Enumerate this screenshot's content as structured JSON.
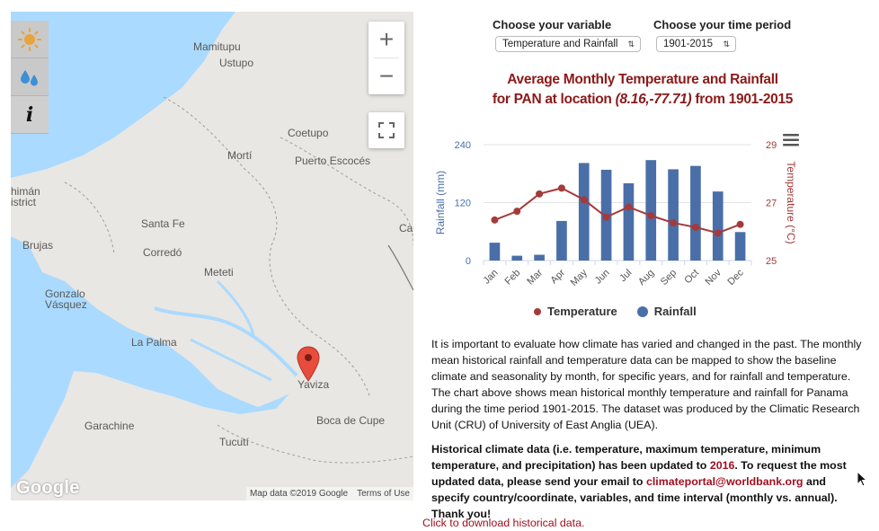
{
  "map": {
    "labels": [
      {
        "id": "mamitupu",
        "text": "Mamitupu"
      },
      {
        "id": "ustupo",
        "text": "Ustupo"
      },
      {
        "id": "coetupo",
        "text": "Coetupo"
      },
      {
        "id": "morti",
        "text": "Mortí"
      },
      {
        "id": "puerto-escoces",
        "text": "Puerto Escocés"
      },
      {
        "id": "chiman",
        "text": "himán"
      },
      {
        "id": "district",
        "text": "istrict"
      },
      {
        "id": "santa-fe",
        "text": "Santa Fe"
      },
      {
        "id": "ca",
        "text": "Ca"
      },
      {
        "id": "brujas",
        "text": "Brujas"
      },
      {
        "id": "corredo",
        "text": "Corredó"
      },
      {
        "id": "meteti",
        "text": "Meteti"
      },
      {
        "id": "gonzalo",
        "text": "Gonzalo"
      },
      {
        "id": "vasquez",
        "text": "Vásquez"
      },
      {
        "id": "la-palma",
        "text": "La Palma"
      },
      {
        "id": "yaviza",
        "text": "Yaviza"
      },
      {
        "id": "boca-de-cupe",
        "text": "Boca de Cupe"
      },
      {
        "id": "garachine",
        "text": "Garachine"
      },
      {
        "id": "tucuti",
        "text": "Tucutí"
      }
    ],
    "zoom_in": "+",
    "zoom_out": "−",
    "info_label": "i",
    "google_logo": "Google",
    "attribution": "Map data ©2019 Google",
    "terms": "Terms of Use"
  },
  "controls": {
    "variable_label": "Choose your variable",
    "variable_value": "Temperature and Rainfall",
    "period_label": "Choose your time period",
    "period_value": "1901-2015"
  },
  "chart_title": {
    "line1": "Average Monthly Temperature and Rainfall",
    "line2_prefix": "for PAN at location ",
    "line2_coords": "(8.16,-77.71)",
    "line2_suffix": " from 1901-2015"
  },
  "chart_data": {
    "type": "bar",
    "categories": [
      "Jan",
      "Feb",
      "Mar",
      "Apr",
      "May",
      "Jun",
      "Jul",
      "Aug",
      "Sep",
      "Oct",
      "Nov",
      "Dec"
    ],
    "series": [
      {
        "name": "Rainfall",
        "type": "bar",
        "axis": "left",
        "values": [
          37,
          10,
          12,
          82,
          202,
          188,
          160,
          208,
          189,
          196,
          143,
          59
        ]
      },
      {
        "name": "Temperature",
        "type": "line",
        "axis": "right",
        "values": [
          26.4,
          26.7,
          27.3,
          27.5,
          27.1,
          26.5,
          26.85,
          26.55,
          26.3,
          26.15,
          25.95,
          26.25
        ]
      }
    ],
    "ylabel_left": "Rainfall (mm)",
    "ylabel_right": "Temperature (°C)",
    "ylim_left": [
      0,
      240
    ],
    "yticks_left": [
      "0",
      "120",
      "240"
    ],
    "ylim_right": [
      25,
      29
    ],
    "yticks_right": [
      "25",
      "27",
      "29"
    ],
    "legend": "bottom-center",
    "grid": true,
    "colors": {
      "rainfall": "#4a6fa8",
      "temperature": "#a53a3a"
    }
  },
  "text": {
    "paragraph1": "It is important to evaluate how climate has varied and changed in the past. The monthly mean historical rainfall and temperature data can be mapped to show the baseline climate and seasonality by month, for specific years, and for rainfall and temperature. The chart above shows mean historical monthly temperature and rainfall for Panama during the time period 1901-2015. The dataset was produced by the Climatic Research Unit (CRU) of University of East Anglia (UEA).",
    "p2_part1": "Historical climate data (i.e. temperature, maximum temperature, minimum temperature, and precipitation) has been updated to ",
    "p2_year": "2016",
    "p2_part2": ". To request the most updated data, please send your email to ",
    "p2_email": "climateportal@worldbank.org",
    "p2_part3": " and specify country/coordinate, variables, and time interval (monthly vs. annual). Thank you!",
    "download": "Click to download historical data."
  }
}
